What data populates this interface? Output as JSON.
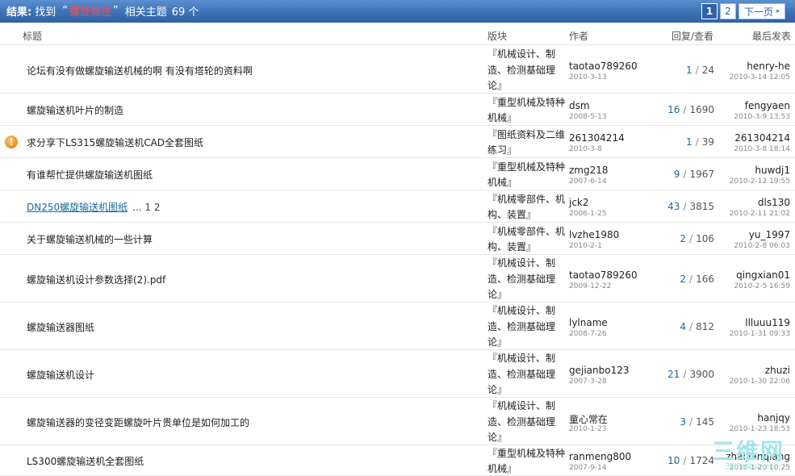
{
  "summary": {
    "label": "结果:",
    "found": "找到",
    "open_quote": "“",
    "keyword": "螺旋输送",
    "close_quote": "”",
    "related": "相关主题",
    "count": "69 个"
  },
  "pager": {
    "page1": "1",
    "page2": "2",
    "next": "下一页",
    "next_arrow": "▸"
  },
  "columns": {
    "title": "标题",
    "forum": "版块",
    "author": "作者",
    "stats": "回复/查看",
    "last": "最后发表"
  },
  "rows": [
    {
      "title": "论坛有没有做螺旋输送机械的啊 有没有塔轮的资料啊",
      "forum": "『机械设计、制造、检测基础理论』",
      "author": "taotao789260",
      "adate": "2010-3-13",
      "replies": "1",
      "views": "24",
      "last": "henry-he",
      "ldate": "2010-3-14 12:05"
    },
    {
      "title": "螺旋输送机叶片的制造",
      "forum": "『重型机械及特种机械』",
      "author": "dsm",
      "adate": "2008-5-13",
      "replies": "16",
      "views": "1690",
      "last": "fengyaen",
      "ldate": "2010-3-9 13:53"
    },
    {
      "title": "求分享下LS315螺旋输送机CAD全套图纸",
      "forum": "『图纸资料及二维练习』",
      "author": "261304214",
      "adate": "2010-3-8",
      "replies": "1",
      "views": "39",
      "last": "261304214",
      "ldate": "2010-3-8 18:14",
      "icon": "!"
    },
    {
      "title": "有谁帮忙提供螺旋输送机图纸",
      "forum": "『重型机械及特种机械』",
      "author": "zmg218",
      "adate": "2007-6-14",
      "replies": "9",
      "views": "1967",
      "last": "huwdj1",
      "ldate": "2010-2-12 19:55"
    },
    {
      "title": "DN250螺旋输送机图纸",
      "pages": "... 1 2",
      "forum": "『机械零部件、机构、装置』",
      "author": "jck2",
      "adate": "2006-1-25",
      "replies": "43",
      "views": "3815",
      "last": "dls130",
      "ldate": "2010-2-11 21:02"
    },
    {
      "title": "关于螺旋输送机械的一些计算",
      "forum": "『机械零部件、机构、装置』",
      "author": "lvzhe1980",
      "adate": "2010-2-1",
      "replies": "2",
      "views": "106",
      "last": "yu_1997",
      "ldate": "2010-2-8 06:03"
    },
    {
      "title": "螺旋输送机设计参数选择(2).pdf",
      "forum": "『机械设计、制造、检测基础理论』",
      "author": "taotao789260",
      "adate": "2009-12-22",
      "replies": "2",
      "views": "166",
      "last": "qingxian01",
      "ldate": "2010-2-5 16:59"
    },
    {
      "title": "螺旋输送器图纸",
      "forum": "『机械设计、制造、检测基础理论』",
      "author": "lylname",
      "adate": "2008-7-26",
      "replies": "4",
      "views": "812",
      "last": "llluuu119",
      "ldate": "2010-1-31 09:33"
    },
    {
      "title": "螺旋输送机设计",
      "forum": "『机械设计、制造、检测基础理论』",
      "author": "gejianbo123",
      "adate": "2007-3-28",
      "replies": "21",
      "views": "3900",
      "last": "zhuzi",
      "ldate": "2010-1-30 22:06"
    },
    {
      "title": "螺旋输送器的变径变距螺旋叶片贵单位是如何加工的",
      "forum": "『机械设计、制造、检测基础理论』",
      "author": "童心常在",
      "adate": "2010-1-23",
      "replies": "3",
      "views": "145",
      "last": "hanjqy",
      "ldate": "2010-1-23 18:53"
    },
    {
      "title": "LS300螺旋输送机全套图纸",
      "forum": "『重型机械及特种机械』",
      "author": "ranmeng800",
      "adate": "2007-9-14",
      "replies": "10",
      "views": "1724",
      "last": "zhaijianqiang",
      "ldate": "2010-1-20 10:25"
    }
  ],
  "watermark": {
    "big": "三维网",
    "small": "3DPortal.cn"
  }
}
